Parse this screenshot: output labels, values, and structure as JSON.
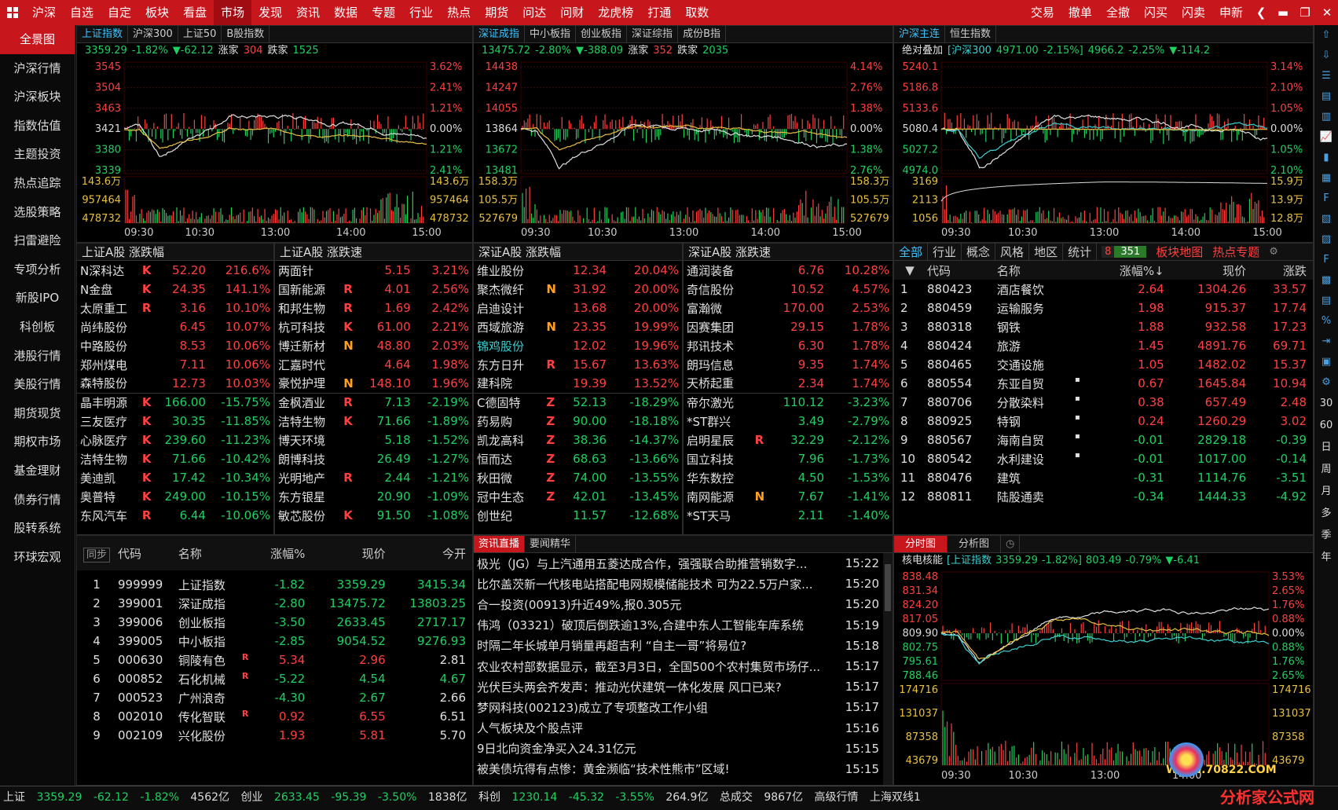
{
  "menu": [
    "沪深",
    "自选",
    "自定",
    "板块",
    "看盘",
    "市场",
    "发现",
    "资讯",
    "数据",
    "专题",
    "行业",
    "热点",
    "期货",
    "问达",
    "问财",
    "龙虎榜",
    "打通",
    "取数"
  ],
  "menu_right": [
    "交易",
    "撤单",
    "全撤",
    "闪买",
    "闪卖",
    "申新"
  ],
  "sidebar": [
    "全景图",
    "沪深行情",
    "沪深板块",
    "指数估值",
    "主题投资",
    "热点追踪",
    "选股策略",
    "扫雷避险",
    "专项分析",
    "新股IPO",
    "科创板",
    "港股行情",
    "美股行情",
    "期货现货",
    "期权市场",
    "基金理财",
    "债券行情",
    "股转系统",
    "环球宏观"
  ],
  "rightbar_text": [
    "30",
    "60",
    "日",
    "周",
    "月",
    "多",
    "季",
    "年"
  ],
  "p1": {
    "tabs": [
      "上证指数",
      "沪深300",
      "上证50",
      "B股指数"
    ],
    "info": {
      "price": "3359.29",
      "pct": "-1.82%",
      "chg": "▼-62.12",
      "up_label": "涨家",
      "up": "304",
      "dn_label": "跌家",
      "dn": "1525"
    },
    "left_price": [
      "3545",
      "3504",
      "3463",
      "3421",
      "3380",
      "3339"
    ],
    "right_pct": [
      "3.62%",
      "2.41%",
      "1.21%",
      "0.00%",
      "1.21%",
      "2.41%"
    ],
    "left_vol": [
      "143.6万",
      "957464",
      "478732"
    ],
    "right_vol": [
      "143.6万",
      "957464",
      "478732"
    ],
    "times": [
      "09:30",
      "10:30",
      "13:00",
      "14:00",
      "15:00"
    ]
  },
  "p2": {
    "tabs": [
      "深证成指",
      "中小板指",
      "创业板指",
      "深证综指",
      "成份B指"
    ],
    "info": {
      "price": "13475.72",
      "pct": "-2.80%",
      "chg": "▼-388.09",
      "up_label": "涨家",
      "up": "352",
      "dn_label": "跌家",
      "dn": "2035"
    },
    "left_price": [
      "14438",
      "14247",
      "14055",
      "13864",
      "13672",
      "13481"
    ],
    "right_pct": [
      "4.14%",
      "2.76%",
      "1.38%",
      "0.00%",
      "1.38%",
      "2.76%"
    ],
    "left_vol": [
      "158.3万",
      "105.5万",
      "527679"
    ],
    "right_vol": [
      "158.3万",
      "105.5万",
      "527679"
    ],
    "times": [
      "09:30",
      "10:30",
      "13:00",
      "14:00",
      "15:00"
    ]
  },
  "p3": {
    "tabs": [
      "沪深主连",
      "恒生指数"
    ],
    "info": {
      "label": "绝对叠加",
      "idx": "[沪深300",
      "idxv": "4971.00",
      "idxp": "-2.15%]",
      "price": "4966.2",
      "pct": "-2.25%",
      "chg": "▼-114.2"
    },
    "left_price": [
      "5240.1",
      "5186.8",
      "5133.6",
      "5080.4",
      "5027.2",
      "4974.0"
    ],
    "right_pct": [
      "3.14%",
      "2.10%",
      "1.05%",
      "0.00%",
      "1.05%",
      "2.10%"
    ],
    "left_vol": [
      "3169",
      "2113",
      "1056"
    ],
    "right_vol": [
      "15.9万",
      "13.9万",
      "12.8万"
    ],
    "times": [
      "09:30",
      "10:30",
      "13:00",
      "14:00",
      "15:00"
    ]
  },
  "rank": [
    {
      "title": "上证A股 涨跌幅",
      "rows": [
        [
          "N深科达",
          "K",
          "52.20",
          "216.6%"
        ],
        [
          "N金盘",
          "K",
          "24.35",
          "141.1%"
        ],
        [
          "太原重工",
          "R",
          "3.16",
          "10.10%"
        ],
        [
          "尚纬股份",
          "",
          "6.45",
          "10.07%"
        ],
        [
          "中路股份",
          "",
          "8.53",
          "10.06%"
        ],
        [
          "郑州煤电",
          "",
          "7.11",
          "10.06%"
        ],
        [
          "森特股份",
          "",
          "12.73",
          "10.03%"
        ],
        [
          "晶丰明源",
          "K",
          "166.00",
          "-15.75%"
        ],
        [
          "三友医疗",
          "K",
          "30.35",
          "-11.85%"
        ],
        [
          "心脉医疗",
          "K",
          "239.60",
          "-11.23%"
        ],
        [
          "洁特生物",
          "K",
          "71.66",
          "-10.42%"
        ],
        [
          "美迪凯",
          "K",
          "17.42",
          "-10.34%"
        ],
        [
          "奥普特",
          "K",
          "249.00",
          "-10.15%"
        ],
        [
          "东风汽车",
          "R",
          "6.44",
          "-10.06%"
        ]
      ]
    },
    {
      "title": "上证A股 涨跌速",
      "rows": [
        [
          "两面针",
          "",
          "5.15",
          "3.21%"
        ],
        [
          "国新能源",
          "R",
          "4.01",
          "2.56%"
        ],
        [
          "和邦生物",
          "R",
          "1.69",
          "2.42%"
        ],
        [
          "杭可科技",
          "K",
          "61.00",
          "2.21%"
        ],
        [
          "博迁新材",
          "N",
          "48.80",
          "2.03%"
        ],
        [
          "汇嘉时代",
          "",
          "4.64",
          "1.98%"
        ],
        [
          "豪悦护理",
          "N",
          "148.10",
          "1.96%"
        ],
        [
          "金枫酒业",
          "R",
          "7.13",
          "-2.19%"
        ],
        [
          "洁特生物",
          "K",
          "71.66",
          "-1.89%"
        ],
        [
          "博天环境",
          "",
          "5.18",
          "-1.52%"
        ],
        [
          "朗博科技",
          "",
          "26.49",
          "-1.27%"
        ],
        [
          "光明地产",
          "R",
          "2.44",
          "-1.21%"
        ],
        [
          "东方银星",
          "",
          "20.90",
          "-1.09%"
        ],
        [
          "敏芯股份",
          "K",
          "91.50",
          "-1.08%"
        ]
      ]
    },
    {
      "title": "深证A股 涨跌幅",
      "rows": [
        [
          "维业股份",
          "",
          "12.34",
          "20.04%"
        ],
        [
          "聚杰微纤",
          "N",
          "31.92",
          "20.00%"
        ],
        [
          "启迪设计",
          "",
          "13.68",
          "20.00%"
        ],
        [
          "西域旅游",
          "N",
          "23.35",
          "19.99%"
        ],
        [
          "锦鸡股份",
          "",
          "12.02",
          "19.96%"
        ],
        [
          "东方日升",
          "R",
          "15.67",
          "13.63%"
        ],
        [
          "建科院",
          "",
          "19.39",
          "13.52%"
        ],
        [
          "C德固特",
          "Z",
          "52.13",
          "-18.29%"
        ],
        [
          "药易购",
          "Z",
          "90.00",
          "-18.18%"
        ],
        [
          "凯龙高科",
          "Z",
          "38.36",
          "-14.37%"
        ],
        [
          "恒而达",
          "Z",
          "68.63",
          "-13.66%"
        ],
        [
          "秋田微",
          "Z",
          "74.00",
          "-13.55%"
        ],
        [
          "冠中生态",
          "Z",
          "42.01",
          "-13.45%"
        ],
        [
          "创世纪",
          "",
          "11.57",
          "-12.68%"
        ]
      ]
    },
    {
      "title": "深证A股 涨跌速",
      "rows": [
        [
          "通润装备",
          "",
          "6.76",
          "10.28%"
        ],
        [
          "奇信股份",
          "",
          "10.52",
          "4.57%"
        ],
        [
          "富瀚微",
          "",
          "170.00",
          "2.53%"
        ],
        [
          "因赛集团",
          "",
          "29.15",
          "1.78%"
        ],
        [
          "邦讯技术",
          "",
          "6.30",
          "1.78%"
        ],
        [
          "朗玛信息",
          "",
          "9.35",
          "1.74%"
        ],
        [
          "天桥起重",
          "",
          "2.34",
          "1.74%"
        ],
        [
          "帝尔激光",
          "",
          "110.12",
          "-3.23%"
        ],
        [
          "*ST群兴",
          "",
          "3.49",
          "-2.79%"
        ],
        [
          "启明星辰",
          "R",
          "32.29",
          "-2.12%"
        ],
        [
          "国立科技",
          "",
          "7.96",
          "-1.73%"
        ],
        [
          "华东数控",
          "",
          "4.50",
          "-1.53%"
        ],
        [
          "南网能源",
          "N",
          "7.67",
          "-1.41%"
        ],
        [
          "*ST天马",
          "",
          "2.11",
          "-1.40%"
        ]
      ]
    }
  ],
  "sector": {
    "tabs": [
      "全部",
      "行业",
      "概念",
      "风格",
      "地区",
      "统计"
    ],
    "count_a": "8",
    "count_b": "351",
    "links": [
      "板块地图",
      "热点专题"
    ],
    "headers": [
      "代码",
      "名称",
      "涨幅%↓",
      "现价",
      "涨跌"
    ],
    "rows": [
      [
        "1",
        "880423",
        "酒店餐饮",
        "",
        "2.64",
        "1304.26",
        "33.57"
      ],
      [
        "2",
        "880459",
        "运输服务",
        "",
        "1.98",
        "915.37",
        "17.74"
      ],
      [
        "3",
        "880318",
        "钢铁",
        "",
        "1.88",
        "932.58",
        "17.23"
      ],
      [
        "4",
        "880424",
        "旅游",
        "",
        "1.45",
        "4891.76",
        "69.71"
      ],
      [
        "5",
        "880465",
        "交通设施",
        "",
        "1.05",
        "1482.02",
        "15.37"
      ],
      [
        "6",
        "880554",
        "东亚自贸",
        "▪",
        "0.67",
        "1645.84",
        "10.94"
      ],
      [
        "7",
        "880706",
        "分散染料",
        "▪",
        "0.38",
        "657.49",
        "2.48"
      ],
      [
        "8",
        "880925",
        "特钢",
        "▪",
        "0.24",
        "1260.29",
        "3.02"
      ],
      [
        "9",
        "880567",
        "海南自贸",
        "▪",
        "-0.01",
        "2829.18",
        "-0.39"
      ],
      [
        "10",
        "880542",
        "水利建设",
        "▪",
        "-0.01",
        "1017.00",
        "-0.14"
      ],
      [
        "11",
        "880476",
        "建筑",
        "",
        "-0.31",
        "1114.76",
        "-3.51"
      ],
      [
        "12",
        "880811",
        "陆股通卖",
        "",
        "-0.34",
        "1444.33",
        "-4.92"
      ]
    ]
  },
  "index": {
    "sync": "同步",
    "headers": [
      "代码",
      "名称",
      "涨幅%",
      "现价",
      "今开"
    ],
    "rows": [
      [
        "1",
        "999999",
        "上证指数",
        "",
        "-1.82",
        "3359.29",
        "3415.34"
      ],
      [
        "2",
        "399001",
        "深证成指",
        "",
        "-2.80",
        "13475.72",
        "13803.25"
      ],
      [
        "3",
        "399006",
        "创业板指",
        "",
        "-3.50",
        "2633.45",
        "2717.17"
      ],
      [
        "4",
        "399005",
        "中小板指",
        "",
        "-2.85",
        "9054.52",
        "9276.93"
      ],
      [
        "5",
        "000630",
        "铜陵有色",
        "R",
        "5.34",
        "2.96",
        "2.81"
      ],
      [
        "6",
        "000852",
        "石化机械",
        "R",
        "-5.22",
        "4.54",
        "4.67"
      ],
      [
        "7",
        "000523",
        "广州浪奇",
        "",
        "-4.30",
        "2.67",
        "2.66"
      ],
      [
        "8",
        "002010",
        "传化智联",
        "R",
        "0.92",
        "6.55",
        "6.51"
      ],
      [
        "9",
        "002109",
        "兴化股份",
        "",
        "1.93",
        "5.81",
        "5.70"
      ]
    ]
  },
  "news": {
    "tabs": [
      "资讯直播",
      "要闻精华"
    ],
    "rows": [
      [
        "极光（JG）与上汽通用五菱达成合作，强强联合助推营销数字...",
        "15:22"
      ],
      [
        "比尔盖茨新一代核电站搭配电网规模储能技术 可为22.5万户家...",
        "15:20"
      ],
      [
        "合一投资(00913)升近49%,报0.305元",
        "15:20"
      ],
      [
        "伟鸿（03321）破顶后倒跌逾13%,合建中东人工智能车库系统",
        "15:19"
      ],
      [
        "时隔二年长城单月销量再超吉利 “自主一哥”将易位?",
        "15:18"
      ],
      [
        "农业农村部数据显示，截至3月3日，全国500个农村集贸市场仔...",
        "15:17"
      ],
      [
        "光伏巨头两会齐发声：推动光伏建筑一体化发展 风口已来?",
        "15:17"
      ],
      [
        "梦网科技(002123)成立了专项整改工作小组",
        "15:17"
      ],
      [
        "人气板块及个股点评",
        "15:16"
      ],
      [
        "9日北向资金净买入24.31亿元",
        "15:15"
      ],
      [
        "被美债坑得有点惨：黄金濒临“技术性熊市”区域!",
        "15:15"
      ]
    ]
  },
  "mini": {
    "tabs": [
      "分时图",
      "分析图"
    ],
    "info": {
      "name": "核电核能",
      "idx": "[上证指数",
      "idxv": "3359.29",
      "idxp": "-1.82%]",
      "price": "803.49",
      "pct": "-0.79%",
      "chg": "▼-6.41"
    },
    "left_price": [
      "838.48",
      "831.34",
      "824.20",
      "817.05",
      "809.90",
      "802.75",
      "795.61",
      "788.46"
    ],
    "right_pct": [
      "3.53%",
      "2.65%",
      "1.76%",
      "0.88%",
      "0.00%",
      "0.88%",
      "1.76%",
      "2.65%"
    ],
    "left_vol": [
      "174716",
      "131037",
      "87358",
      "43679"
    ],
    "right_vol": [
      "174716",
      "131037",
      "87358",
      "43679"
    ],
    "times": [
      "09:30",
      "10:30",
      "13:00",
      "14:00"
    ]
  },
  "status": {
    "sh_label": "上证",
    "sh": "3359.29",
    "sh_chg": "-62.12",
    "sh_pct": "-1.82%",
    "sh_amt": "4562亿",
    "cy_label": "创业",
    "cy": "2633.45",
    "cy_chg": "-95.39",
    "cy_pct": "-3.50%",
    "cy_amt": "1838亿",
    "kc_label": "科创",
    "kc": "1230.14",
    "kc_chg": "-45.32",
    "kc_pct": "-3.55%",
    "kc_amt": "264.9亿",
    "total_label": "总成交",
    "total": "9867亿",
    "l2": "高级行情",
    "l3": "上海双线1"
  },
  "watermark": {
    "brand": "分析家公式网",
    "url": "WWW.70822.COM"
  },
  "colors": {
    "red": "#c8161d",
    "up": "#ff4040",
    "down": "#20d060",
    "white_line": "#e0e0e0",
    "yellow_line": "#e8c040",
    "cyan_line": "#3ccfd0"
  }
}
